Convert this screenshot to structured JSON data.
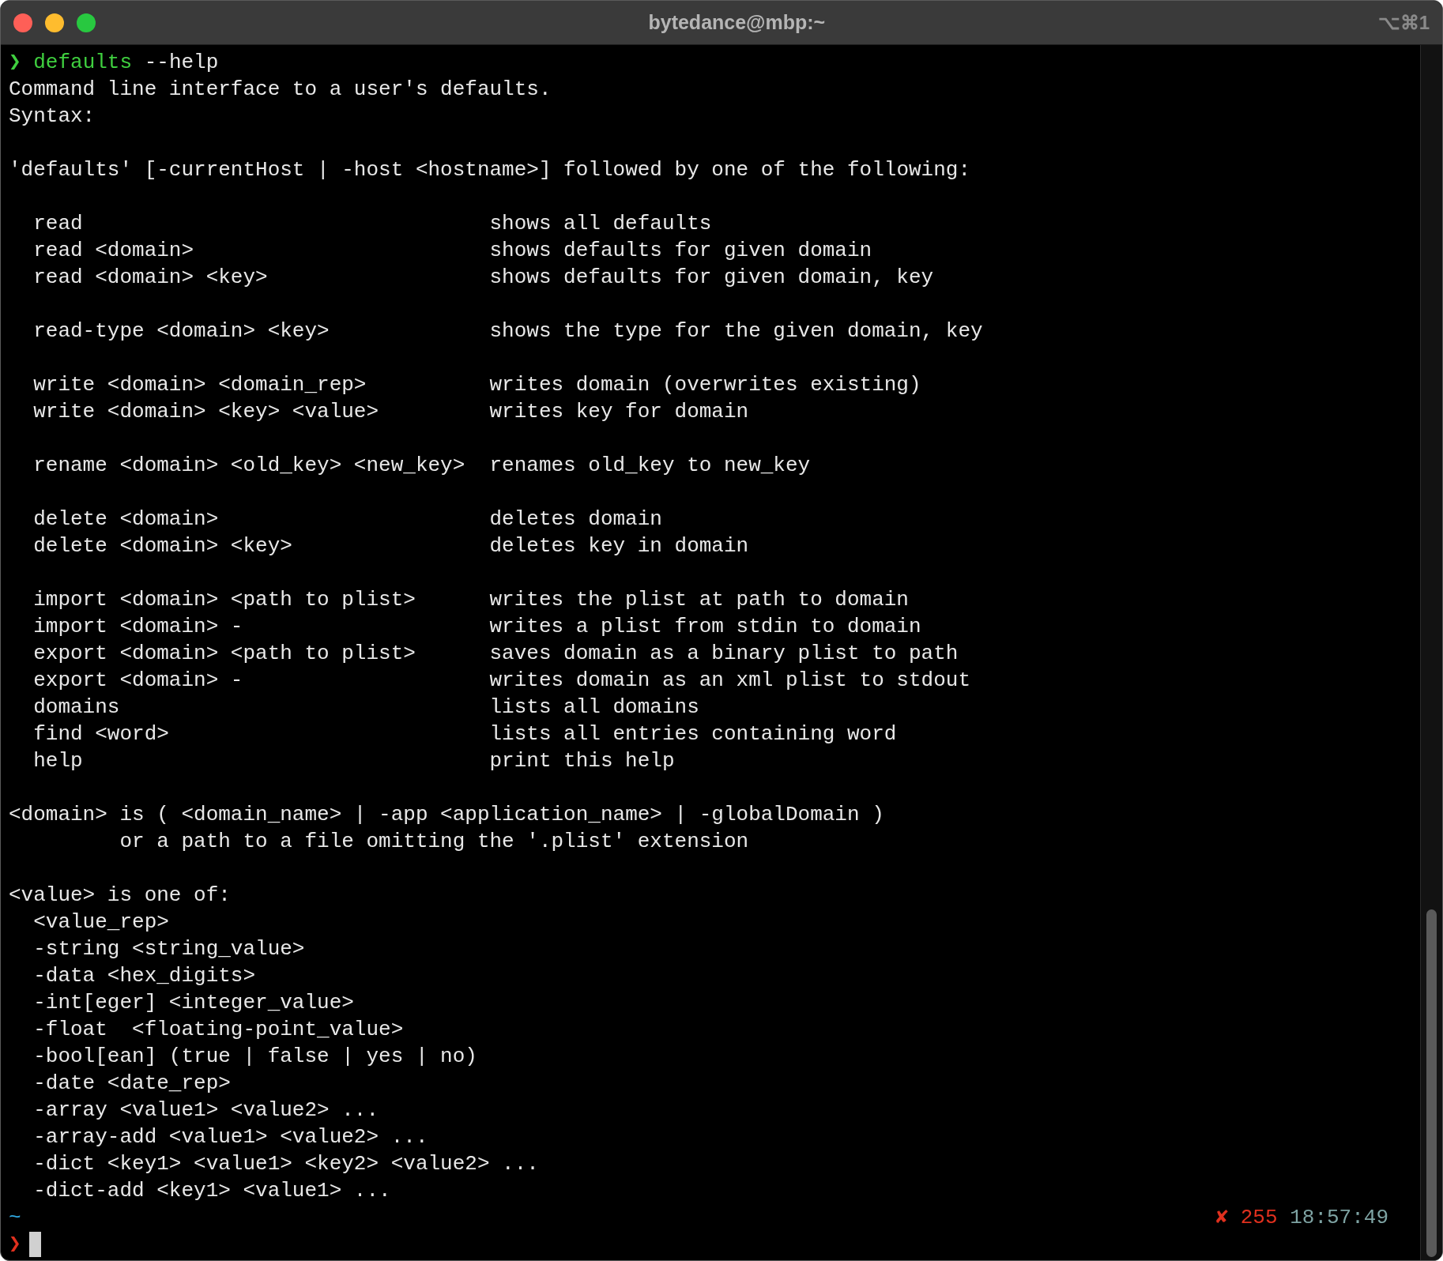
{
  "window": {
    "title": "bytedance@mbp:~",
    "shortcut": "⌥⌘1"
  },
  "command_line": {
    "prompt_symbol": "❯",
    "command": "defaults",
    "arguments": "--help"
  },
  "output": [
    [
      {
        "kind": "text",
        "text": "Command line interface to a user's defaults."
      },
      {
        "kind": "text",
        "text": "Syntax:"
      }
    ],
    [
      {
        "kind": "text",
        "text": "'defaults' [-currentHost | -host <hostname>] followed by one of the following:"
      }
    ],
    [
      {
        "kind": "entry",
        "command": "read",
        "description": "shows all defaults"
      },
      {
        "kind": "entry",
        "command": "read <domain>",
        "description": "shows defaults for given domain"
      },
      {
        "kind": "entry",
        "command": "read <domain> <key>",
        "description": "shows defaults for given domain, key"
      }
    ],
    [
      {
        "kind": "entry",
        "command": "read-type <domain> <key>",
        "description": "shows the type for the given domain, key"
      }
    ],
    [
      {
        "kind": "entry",
        "command": "write <domain> <domain_rep>",
        "description": "writes domain (overwrites existing)"
      },
      {
        "kind": "entry",
        "command": "write <domain> <key> <value>",
        "description": "writes key for domain"
      }
    ],
    [
      {
        "kind": "entry",
        "command": "rename <domain> <old_key> <new_key>",
        "description": "renames old_key to new_key"
      }
    ],
    [
      {
        "kind": "entry",
        "command": "delete <domain>",
        "description": "deletes domain"
      },
      {
        "kind": "entry",
        "command": "delete <domain> <key>",
        "description": "deletes key in domain"
      }
    ],
    [
      {
        "kind": "entry",
        "command": "import <domain> <path to plist>",
        "description": "writes the plist at path to domain"
      },
      {
        "kind": "entry",
        "command": "import <domain> -",
        "description": "writes a plist from stdin to domain"
      },
      {
        "kind": "entry",
        "command": "export <domain> <path to plist>",
        "description": "saves domain as a binary plist to path"
      },
      {
        "kind": "entry",
        "command": "export <domain> -",
        "description": "writes domain as an xml plist to stdout"
      },
      {
        "kind": "entry",
        "command": "domains",
        "description": "lists all domains"
      },
      {
        "kind": "entry",
        "command": "find <word>",
        "description": "lists all entries containing word"
      },
      {
        "kind": "entry",
        "command": "help",
        "description": "print this help"
      }
    ],
    [
      {
        "kind": "text",
        "text": "<domain> is ( <domain_name> | -app <application_name> | -globalDomain )"
      },
      {
        "kind": "continuation",
        "text": "or a path to a file omitting the '.plist' extension"
      }
    ],
    [
      {
        "kind": "text",
        "text": "<value> is one of:"
      },
      {
        "kind": "indented",
        "text": "<value_rep>"
      },
      {
        "kind": "indented",
        "text": "-string <string_value>"
      },
      {
        "kind": "indented",
        "text": "-data <hex_digits>"
      },
      {
        "kind": "indented",
        "text": "-int[eger] <integer_value>"
      },
      {
        "kind": "indented",
        "text": "-float  <floating-point_value>"
      },
      {
        "kind": "indented",
        "text": "-bool[ean] (true | false | yes | no)"
      },
      {
        "kind": "indented",
        "text": "-date <date_rep>"
      },
      {
        "kind": "indented",
        "text": "-array <value1> <value2> ..."
      },
      {
        "kind": "indented",
        "text": "-array-add <value1> <value2> ..."
      },
      {
        "kind": "indented",
        "text": "-dict <key1> <value1> <key2> <value2> ..."
      },
      {
        "kind": "indented",
        "text": "-dict-add <key1> <value1> ..."
      }
    ]
  ],
  "status_line": {
    "directory": "~",
    "error_mark": "✘",
    "exit_code": "255",
    "time": "18:57:49"
  },
  "input_line": {
    "prompt_symbol": "❯"
  }
}
